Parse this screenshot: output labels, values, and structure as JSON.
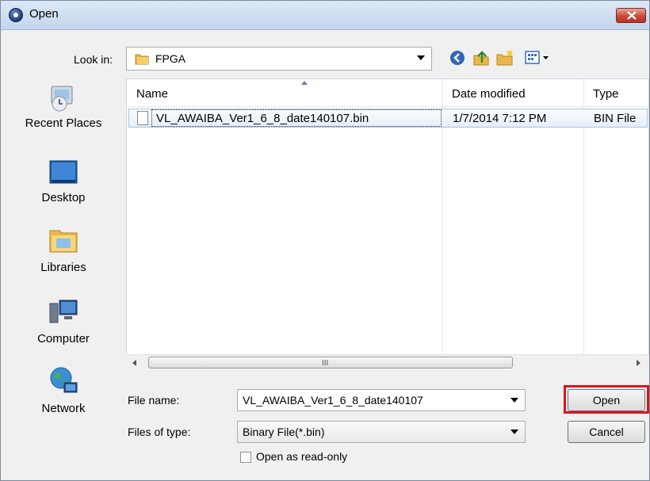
{
  "window": {
    "title": "Open",
    "close_icon": "close-icon"
  },
  "toolbar": {
    "look_in_label": "Look in:",
    "look_in_value": "FPGA",
    "buttons": [
      "back-icon",
      "up-folder-icon",
      "new-folder-icon",
      "view-menu-icon"
    ]
  },
  "places": [
    {
      "label": "Recent Places",
      "icon": "recent-places-icon"
    },
    {
      "label": "Desktop",
      "icon": "desktop-icon"
    },
    {
      "label": "Libraries",
      "icon": "libraries-icon"
    },
    {
      "label": "Computer",
      "icon": "computer-icon"
    },
    {
      "label": "Network",
      "icon": "network-icon"
    }
  ],
  "file_list": {
    "columns": [
      "Name",
      "Date modified",
      "Type"
    ],
    "rows": [
      {
        "name": "VL_AWAIBA_Ver1_6_8_date140107.bin",
        "date_modified": "1/7/2014 7:12 PM",
        "type": "BIN File",
        "selected": true
      }
    ],
    "scroll_grip": "III"
  },
  "form": {
    "file_name_label": "File name:",
    "file_name_value": "VL_AWAIBA_Ver1_6_8_date140107",
    "files_of_type_label": "Files of type:",
    "files_of_type_value": "Binary File(*.bin)",
    "read_only_label": "Open as read-only",
    "read_only_checked": false,
    "open_label": "Open",
    "cancel_label": "Cancel"
  },
  "colors": {
    "highlight": "#d9141c",
    "selection": "#a9c2e6"
  }
}
